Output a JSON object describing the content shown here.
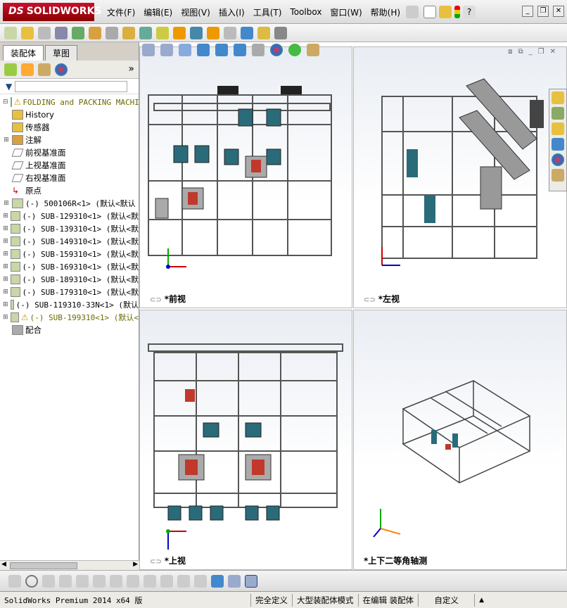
{
  "app": {
    "brand": "SOLIDWORKS",
    "brand_prefix": "DS"
  },
  "menu": [
    "文件(F)",
    "编辑(E)",
    "视图(V)",
    "插入(I)",
    "工具(T)",
    "Toolbox",
    "窗口(W)",
    "帮助(H)"
  ],
  "tabs": [
    "装配体",
    "草图"
  ],
  "tree": {
    "root": "FOLDING and PACKING MACHINE",
    "items": [
      {
        "label": "History",
        "icon": "history-icon",
        "mono": false
      },
      {
        "label": "传感器",
        "icon": "sensor-icon",
        "mono": false
      },
      {
        "label": "注解",
        "icon": "annotation-icon",
        "mono": false,
        "expand": true
      },
      {
        "label": "前视基准面",
        "icon": "plane-icon",
        "mono": false
      },
      {
        "label": "上视基准面",
        "icon": "plane-icon",
        "mono": false
      },
      {
        "label": "右视基准面",
        "icon": "plane-icon",
        "mono": false
      },
      {
        "label": "原点",
        "icon": "origin-icon",
        "mono": false
      },
      {
        "label": "(-) 500106R<1> (默认<默认",
        "icon": "part-icon",
        "mono": true,
        "expand": true
      },
      {
        "label": "(-) SUB-129310<1> (默认<默",
        "icon": "subassembly-icon",
        "mono": true,
        "expand": true
      },
      {
        "label": "(-) SUB-139310<1> (默认<默",
        "icon": "subassembly-icon",
        "mono": true,
        "expand": true
      },
      {
        "label": "(-) SUB-149310<1> (默认<默",
        "icon": "subassembly-icon",
        "mono": true,
        "expand": true
      },
      {
        "label": "(-) SUB-159310<1> (默认<默",
        "icon": "subassembly-icon",
        "mono": true,
        "expand": true
      },
      {
        "label": "(-) SUB-169310<1> (默认<默",
        "icon": "subassembly-icon",
        "mono": true,
        "expand": true
      },
      {
        "label": "(-) SUB-189310<1> (默认<默",
        "icon": "subassembly-icon",
        "mono": true,
        "expand": true
      },
      {
        "label": "(-) SUB-179310<1> (默认<默",
        "icon": "subassembly-icon",
        "mono": true,
        "expand": true
      },
      {
        "label": "(-) SUB-119310-33N<1> (默认",
        "icon": "subassembly-icon",
        "mono": true,
        "expand": true
      },
      {
        "label": "(-) SUB-199310<1> (默认<",
        "icon": "subassembly-icon",
        "mono": true,
        "expand": true,
        "warning": true
      },
      {
        "label": "配合",
        "icon": "mates-icon",
        "mono": false
      }
    ]
  },
  "viewports": {
    "front": "*前视",
    "left": "*左视",
    "top": "*上视",
    "iso": "*上下二等角轴测"
  },
  "status": {
    "app_version": "SolidWorks Premium 2014 x64 版",
    "state1": "完全定义",
    "state2": "大型装配体模式",
    "state3": "在编辑 装配体",
    "state4": "自定义",
    "caret": "▲"
  },
  "colors": {
    "brand": "#c8102e",
    "frame": "#555555",
    "motor": "#2a6b7a",
    "axis_x": "#cc0000",
    "axis_y": "#00aa00",
    "axis_z": "#0000cc"
  }
}
